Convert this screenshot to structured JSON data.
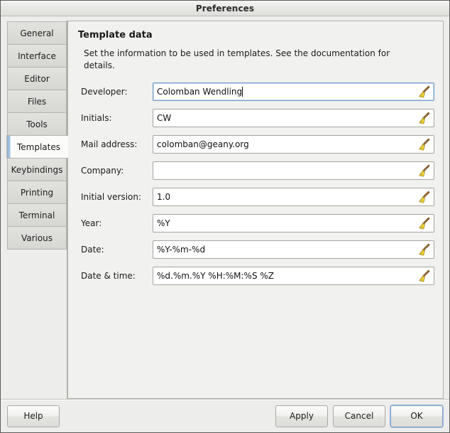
{
  "window": {
    "title": "Preferences"
  },
  "sidebar": {
    "items": [
      {
        "label": "General",
        "selected": false
      },
      {
        "label": "Interface",
        "selected": false
      },
      {
        "label": "Editor",
        "selected": false
      },
      {
        "label": "Files",
        "selected": false
      },
      {
        "label": "Tools",
        "selected": false
      },
      {
        "label": "Templates",
        "selected": true
      },
      {
        "label": "Keybindings",
        "selected": false
      },
      {
        "label": "Printing",
        "selected": false
      },
      {
        "label": "Terminal",
        "selected": false
      },
      {
        "label": "Various",
        "selected": false
      }
    ]
  },
  "content": {
    "heading": "Template data",
    "description": "Set the information to be used in templates. See the documentation for details.",
    "fields": [
      {
        "label": "Developer:",
        "value": "Colomban Wendling",
        "focused": true,
        "clear_icon": "broom-icon"
      },
      {
        "label": "Initials:",
        "value": "CW",
        "focused": false,
        "clear_icon": "broom-icon"
      },
      {
        "label": "Mail address:",
        "value": "colomban@geany.org",
        "focused": false,
        "clear_icon": "broom-icon"
      },
      {
        "label": "Company:",
        "value": "",
        "focused": false,
        "clear_icon": "broom-icon"
      },
      {
        "label": "Initial version:",
        "value": "1.0",
        "focused": false,
        "clear_icon": "broom-icon"
      },
      {
        "label": "Year:",
        "value": "%Y",
        "focused": false,
        "clear_icon": "broom-icon"
      },
      {
        "label": "Date:",
        "value": "%Y-%m-%d",
        "focused": false,
        "clear_icon": "broom-icon"
      },
      {
        "label": "Date & time:",
        "value": "%d.%m.%Y %H:%M:%S %Z",
        "focused": false,
        "clear_icon": "broom-icon"
      }
    ]
  },
  "footer": {
    "help_label": "Help",
    "apply_label": "Apply",
    "cancel_label": "Cancel",
    "ok_label": "OK",
    "default_button": "OK"
  },
  "colors": {
    "window_bg": "#ededeb",
    "panel_bg": "#f1f1ef",
    "selected_tab_bg": "#fbfbfa",
    "focus_blue": "#6f9bcb",
    "tab_indicator": "#93b5dc",
    "broom_bristles": "#f2da3e",
    "broom_handle": "#a8743a"
  }
}
